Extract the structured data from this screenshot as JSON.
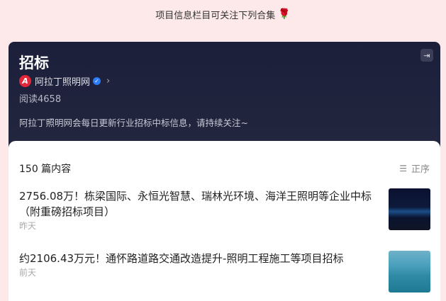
{
  "banner": {
    "text": "项目信息栏目可关注下列合集",
    "emoji": "🌹"
  },
  "header": {
    "title": "招标",
    "author": "阿拉丁照明网",
    "logo_letter": "A",
    "reads": "阅读4658",
    "description": "阿拉丁照明网会每日更新行业招标中标信息，请持续关注~"
  },
  "list": {
    "count": "150 篇内容",
    "sort_label": "正序",
    "items": [
      {
        "title": "2756.08万！栋梁国际、永恒光智慧、瑞林光环境、海洋王照明等企业中标（附重磅招标项目）",
        "time": "昨天"
      },
      {
        "title": "约2106.43万元！通怀路道路交通改造提升-照明工程施工等项目招标",
        "time": "前天"
      }
    ]
  }
}
